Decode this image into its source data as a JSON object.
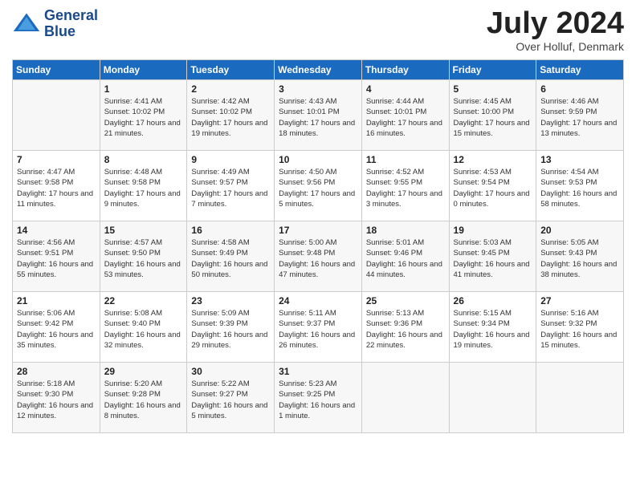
{
  "header": {
    "logo_line1": "General",
    "logo_line2": "Blue",
    "month_title": "July 2024",
    "subtitle": "Over Holluf, Denmark"
  },
  "days_of_week": [
    "Sunday",
    "Monday",
    "Tuesday",
    "Wednesday",
    "Thursday",
    "Friday",
    "Saturday"
  ],
  "weeks": [
    [
      {
        "day": "",
        "sunrise": "",
        "sunset": "",
        "daylight": ""
      },
      {
        "day": "1",
        "sunrise": "Sunrise: 4:41 AM",
        "sunset": "Sunset: 10:02 PM",
        "daylight": "Daylight: 17 hours and 21 minutes."
      },
      {
        "day": "2",
        "sunrise": "Sunrise: 4:42 AM",
        "sunset": "Sunset: 10:02 PM",
        "daylight": "Daylight: 17 hours and 19 minutes."
      },
      {
        "day": "3",
        "sunrise": "Sunrise: 4:43 AM",
        "sunset": "Sunset: 10:01 PM",
        "daylight": "Daylight: 17 hours and 18 minutes."
      },
      {
        "day": "4",
        "sunrise": "Sunrise: 4:44 AM",
        "sunset": "Sunset: 10:01 PM",
        "daylight": "Daylight: 17 hours and 16 minutes."
      },
      {
        "day": "5",
        "sunrise": "Sunrise: 4:45 AM",
        "sunset": "Sunset: 10:00 PM",
        "daylight": "Daylight: 17 hours and 15 minutes."
      },
      {
        "day": "6",
        "sunrise": "Sunrise: 4:46 AM",
        "sunset": "Sunset: 9:59 PM",
        "daylight": "Daylight: 17 hours and 13 minutes."
      }
    ],
    [
      {
        "day": "7",
        "sunrise": "Sunrise: 4:47 AM",
        "sunset": "Sunset: 9:58 PM",
        "daylight": "Daylight: 17 hours and 11 minutes."
      },
      {
        "day": "8",
        "sunrise": "Sunrise: 4:48 AM",
        "sunset": "Sunset: 9:58 PM",
        "daylight": "Daylight: 17 hours and 9 minutes."
      },
      {
        "day": "9",
        "sunrise": "Sunrise: 4:49 AM",
        "sunset": "Sunset: 9:57 PM",
        "daylight": "Daylight: 17 hours and 7 minutes."
      },
      {
        "day": "10",
        "sunrise": "Sunrise: 4:50 AM",
        "sunset": "Sunset: 9:56 PM",
        "daylight": "Daylight: 17 hours and 5 minutes."
      },
      {
        "day": "11",
        "sunrise": "Sunrise: 4:52 AM",
        "sunset": "Sunset: 9:55 PM",
        "daylight": "Daylight: 17 hours and 3 minutes."
      },
      {
        "day": "12",
        "sunrise": "Sunrise: 4:53 AM",
        "sunset": "Sunset: 9:54 PM",
        "daylight": "Daylight: 17 hours and 0 minutes."
      },
      {
        "day": "13",
        "sunrise": "Sunrise: 4:54 AM",
        "sunset": "Sunset: 9:53 PM",
        "daylight": "Daylight: 16 hours and 58 minutes."
      }
    ],
    [
      {
        "day": "14",
        "sunrise": "Sunrise: 4:56 AM",
        "sunset": "Sunset: 9:51 PM",
        "daylight": "Daylight: 16 hours and 55 minutes."
      },
      {
        "day": "15",
        "sunrise": "Sunrise: 4:57 AM",
        "sunset": "Sunset: 9:50 PM",
        "daylight": "Daylight: 16 hours and 53 minutes."
      },
      {
        "day": "16",
        "sunrise": "Sunrise: 4:58 AM",
        "sunset": "Sunset: 9:49 PM",
        "daylight": "Daylight: 16 hours and 50 minutes."
      },
      {
        "day": "17",
        "sunrise": "Sunrise: 5:00 AM",
        "sunset": "Sunset: 9:48 PM",
        "daylight": "Daylight: 16 hours and 47 minutes."
      },
      {
        "day": "18",
        "sunrise": "Sunrise: 5:01 AM",
        "sunset": "Sunset: 9:46 PM",
        "daylight": "Daylight: 16 hours and 44 minutes."
      },
      {
        "day": "19",
        "sunrise": "Sunrise: 5:03 AM",
        "sunset": "Sunset: 9:45 PM",
        "daylight": "Daylight: 16 hours and 41 minutes."
      },
      {
        "day": "20",
        "sunrise": "Sunrise: 5:05 AM",
        "sunset": "Sunset: 9:43 PM",
        "daylight": "Daylight: 16 hours and 38 minutes."
      }
    ],
    [
      {
        "day": "21",
        "sunrise": "Sunrise: 5:06 AM",
        "sunset": "Sunset: 9:42 PM",
        "daylight": "Daylight: 16 hours and 35 minutes."
      },
      {
        "day": "22",
        "sunrise": "Sunrise: 5:08 AM",
        "sunset": "Sunset: 9:40 PM",
        "daylight": "Daylight: 16 hours and 32 minutes."
      },
      {
        "day": "23",
        "sunrise": "Sunrise: 5:09 AM",
        "sunset": "Sunset: 9:39 PM",
        "daylight": "Daylight: 16 hours and 29 minutes."
      },
      {
        "day": "24",
        "sunrise": "Sunrise: 5:11 AM",
        "sunset": "Sunset: 9:37 PM",
        "daylight": "Daylight: 16 hours and 26 minutes."
      },
      {
        "day": "25",
        "sunrise": "Sunrise: 5:13 AM",
        "sunset": "Sunset: 9:36 PM",
        "daylight": "Daylight: 16 hours and 22 minutes."
      },
      {
        "day": "26",
        "sunrise": "Sunrise: 5:15 AM",
        "sunset": "Sunset: 9:34 PM",
        "daylight": "Daylight: 16 hours and 19 minutes."
      },
      {
        "day": "27",
        "sunrise": "Sunrise: 5:16 AM",
        "sunset": "Sunset: 9:32 PM",
        "daylight": "Daylight: 16 hours and 15 minutes."
      }
    ],
    [
      {
        "day": "28",
        "sunrise": "Sunrise: 5:18 AM",
        "sunset": "Sunset: 9:30 PM",
        "daylight": "Daylight: 16 hours and 12 minutes."
      },
      {
        "day": "29",
        "sunrise": "Sunrise: 5:20 AM",
        "sunset": "Sunset: 9:28 PM",
        "daylight": "Daylight: 16 hours and 8 minutes."
      },
      {
        "day": "30",
        "sunrise": "Sunrise: 5:22 AM",
        "sunset": "Sunset: 9:27 PM",
        "daylight": "Daylight: 16 hours and 5 minutes."
      },
      {
        "day": "31",
        "sunrise": "Sunrise: 5:23 AM",
        "sunset": "Sunset: 9:25 PM",
        "daylight": "Daylight: 16 hours and 1 minute."
      },
      {
        "day": "",
        "sunrise": "",
        "sunset": "",
        "daylight": ""
      },
      {
        "day": "",
        "sunrise": "",
        "sunset": "",
        "daylight": ""
      },
      {
        "day": "",
        "sunrise": "",
        "sunset": "",
        "daylight": ""
      }
    ]
  ]
}
